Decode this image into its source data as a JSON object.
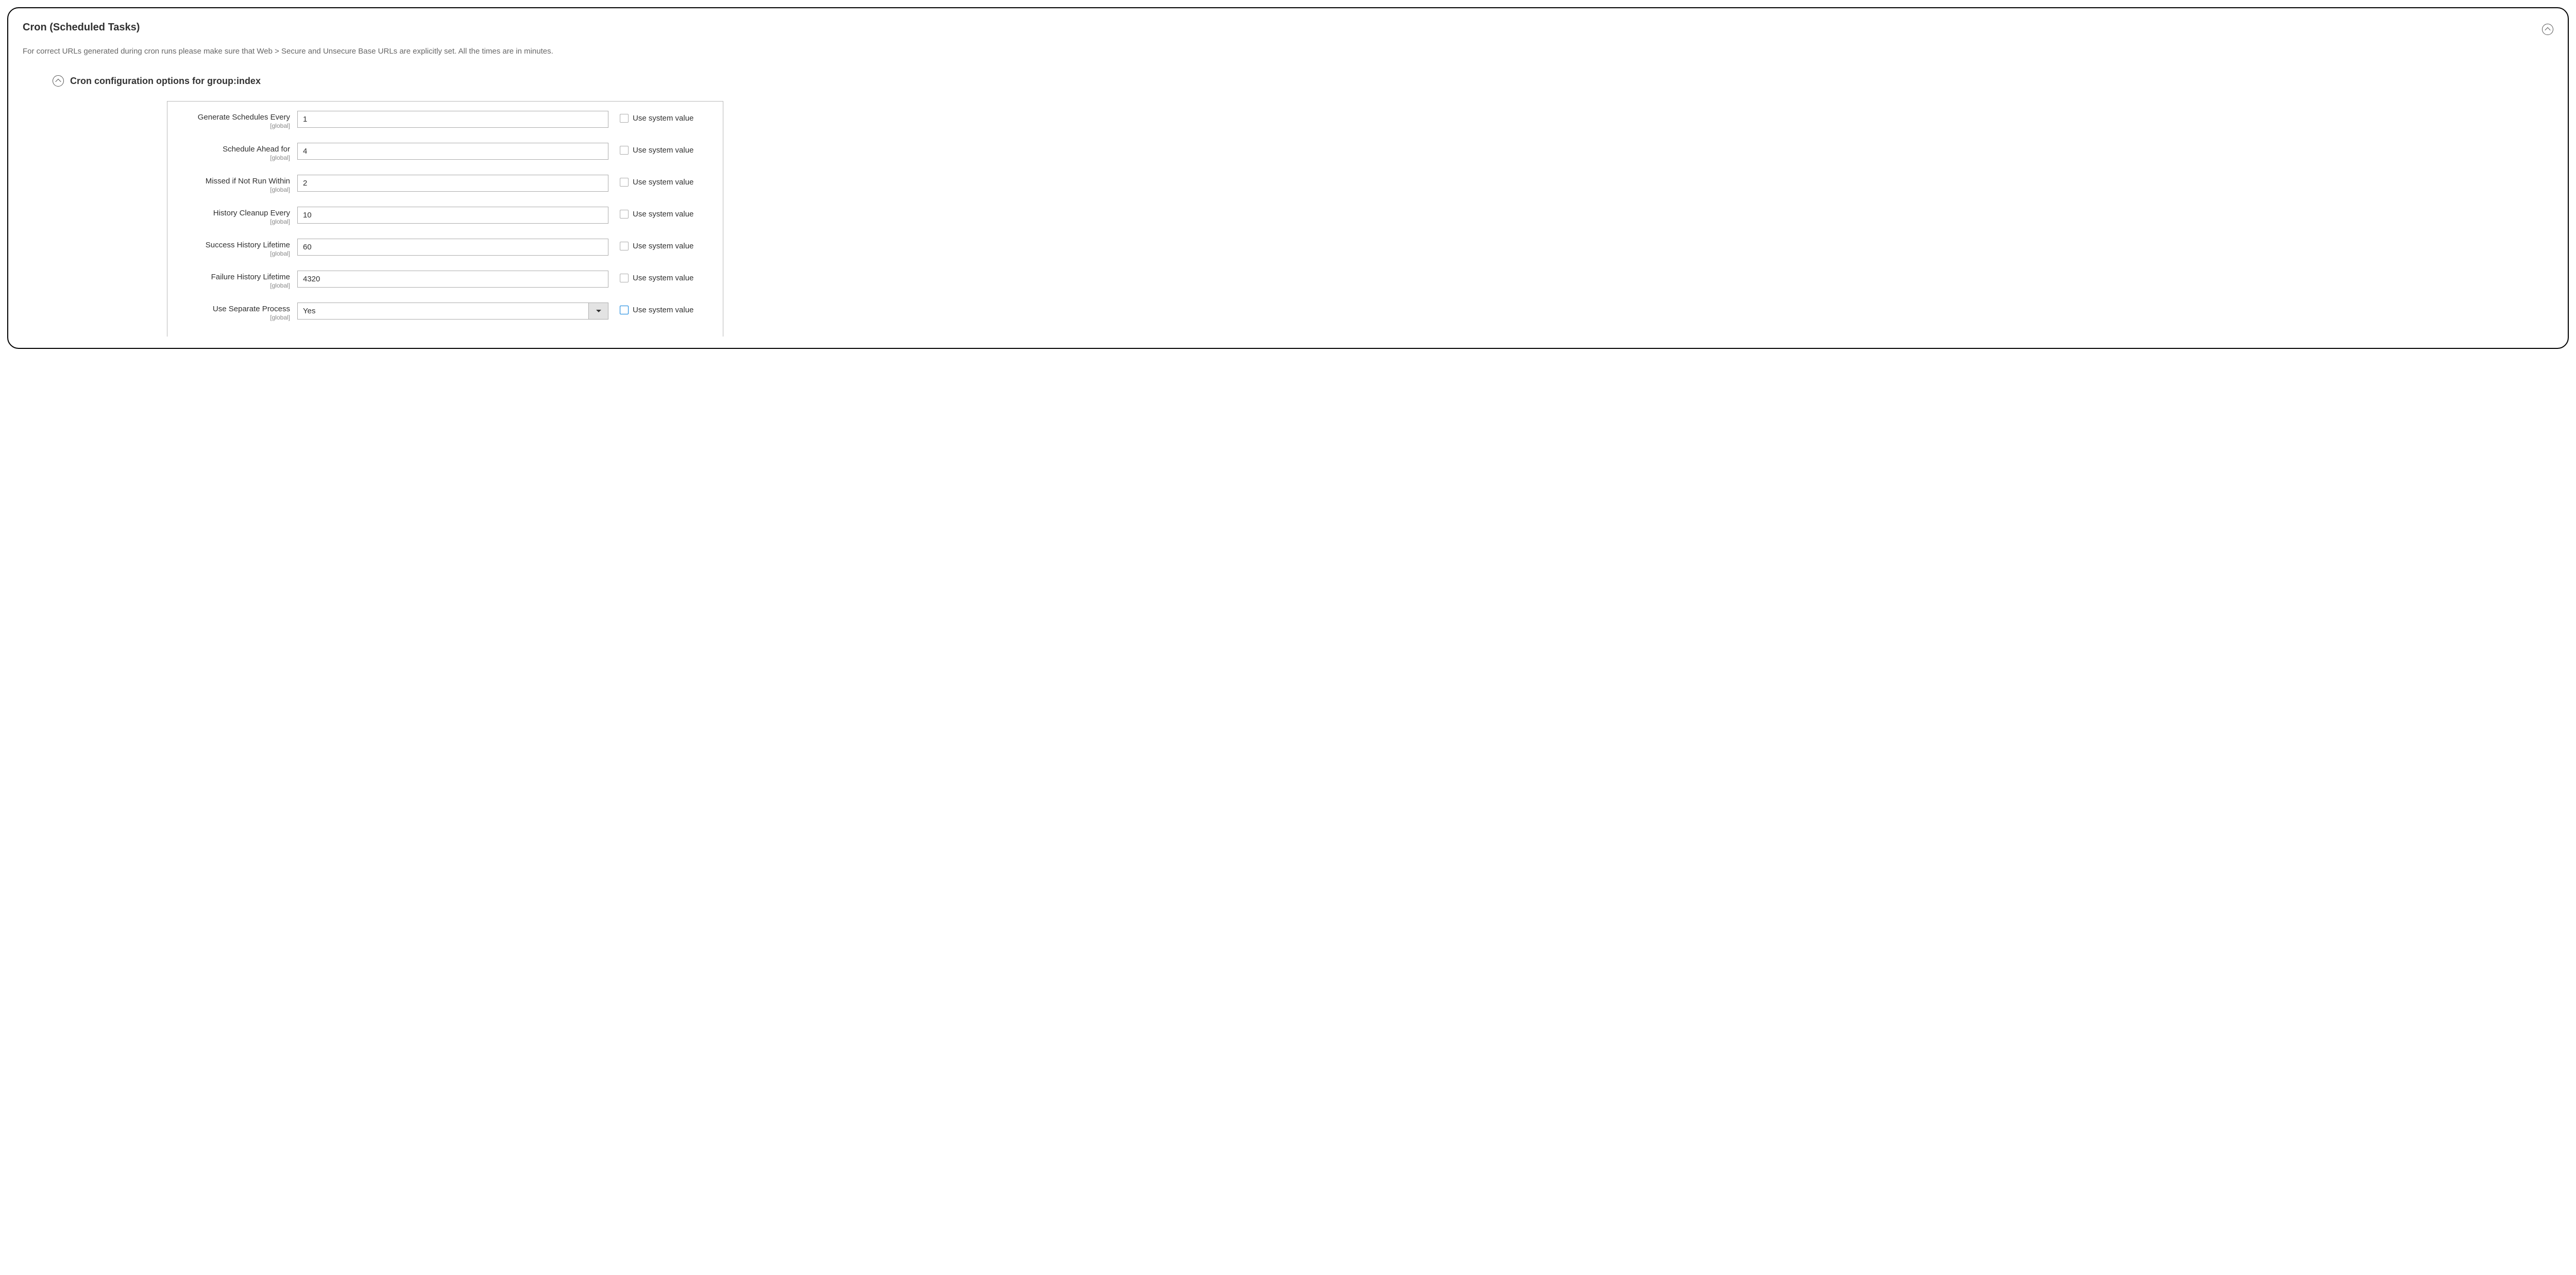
{
  "panel": {
    "title": "Cron (Scheduled Tasks)",
    "notice": "For correct URLs generated during cron runs please make sure that Web > Secure and Unsecure Base URLs are explicitly set. All the times are in minutes."
  },
  "group": {
    "title": "Cron configuration options for group:index"
  },
  "scope_label": "[global]",
  "use_system_label": "Use system value",
  "fields": [
    {
      "label": "Generate Schedules Every",
      "value": "1",
      "type": "text",
      "highlight": false
    },
    {
      "label": "Schedule Ahead for",
      "value": "4",
      "type": "text",
      "highlight": false
    },
    {
      "label": "Missed if Not Run Within",
      "value": "2",
      "type": "text",
      "highlight": false
    },
    {
      "label": "History Cleanup Every",
      "value": "10",
      "type": "text",
      "highlight": false
    },
    {
      "label": "Success History Lifetime",
      "value": "60",
      "type": "text",
      "highlight": false
    },
    {
      "label": "Failure History Lifetime",
      "value": "4320",
      "type": "text",
      "highlight": false
    },
    {
      "label": "Use Separate Process",
      "value": "Yes",
      "type": "select",
      "highlight": true
    }
  ]
}
